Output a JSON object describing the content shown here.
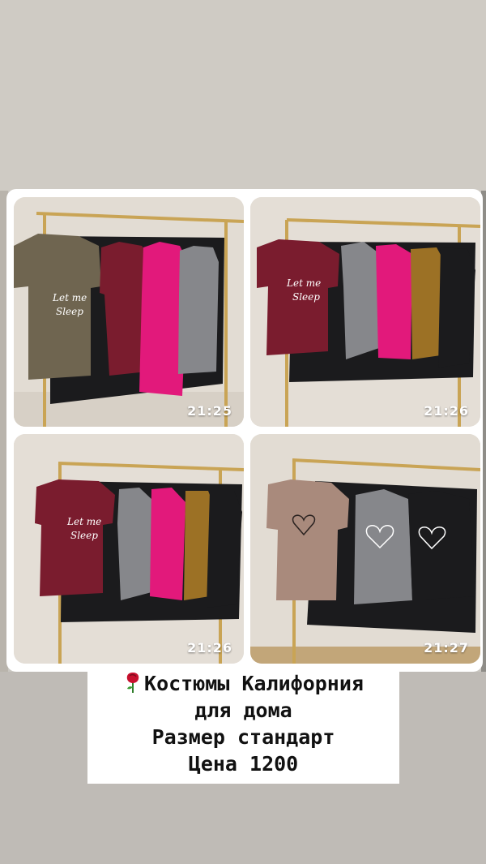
{
  "tiles": [
    {
      "time": "21:25"
    },
    {
      "time": "21:26"
    },
    {
      "time": "21:26"
    },
    {
      "time": "21:27"
    }
  ],
  "prints": {
    "text1": "Let me",
    "text2": "Sleep"
  },
  "caption": {
    "line1": "Костюмы Калифорния",
    "line2": "для дома",
    "line3": "Размер стандарт",
    "line4": "Цена 1200"
  },
  "icons": {
    "caption_icon": "rose-icon"
  },
  "colors": {
    "brown": "#6f6550",
    "burgundy": "#7a1c2e",
    "pink": "#e2197b",
    "gray": "#86878b",
    "mustard": "#9c7125",
    "black": "#1b1b1d",
    "beige": "#a98a7c"
  }
}
